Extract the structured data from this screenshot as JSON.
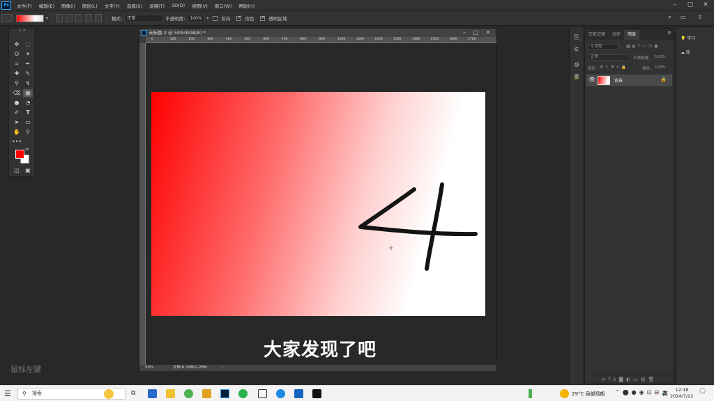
{
  "menubar": {
    "items": [
      "文件(F)",
      "编辑(E)",
      "图像(I)",
      "图层(L)",
      "文字(Y)",
      "选择(S)",
      "滤镜(T)",
      "3D(D)",
      "视图(V)",
      "窗口(W)",
      "帮助(H)"
    ],
    "logo": "Ps"
  },
  "options": {
    "mode_label": "模式:",
    "mode_value": "正常",
    "opacity_label": "不透明度:",
    "opacity_value": "100%",
    "reverse_label": "反向",
    "dither_label": "仿色",
    "transparency_label": "透明区域"
  },
  "document": {
    "tab_title": "未标题-2 @ 50%(RGB/8) *",
    "ruler_h_labels": [
      "0",
      "100",
      "200",
      "300",
      "400",
      "500",
      "600",
      "700",
      "800",
      "900",
      "1000",
      "1100",
      "1200",
      "1300",
      "1400",
      "1500",
      "1600",
      "1700"
    ],
    "zoom": "50%",
    "status": "文档:6.19M/2.28M",
    "subtitle": "大家发现了吧",
    "drawn_digit": "4"
  },
  "watermark": "鼠标左键",
  "panels": {
    "tabs": [
      "历史记录",
      "动作",
      "图层"
    ],
    "active_tab": "图层",
    "kind_filter": "类型",
    "blend_mode": "正常",
    "opacity_label": "不透明度:",
    "opacity_value": "100%",
    "lock_label": "锁定:",
    "fill_label": "填充:",
    "fill_value": "100%",
    "layer_name": "背景",
    "learn_label": "学习",
    "libraries_label": "库"
  },
  "taskbar": {
    "search_placeholder": "搜索",
    "weather": "29°C 局部晴朗",
    "ime": "英",
    "time": "12:18",
    "date": "2024/7/22"
  },
  "colors": {
    "foreground": "#ff0000",
    "background": "#ffffff",
    "accent": "#31a8ff"
  }
}
